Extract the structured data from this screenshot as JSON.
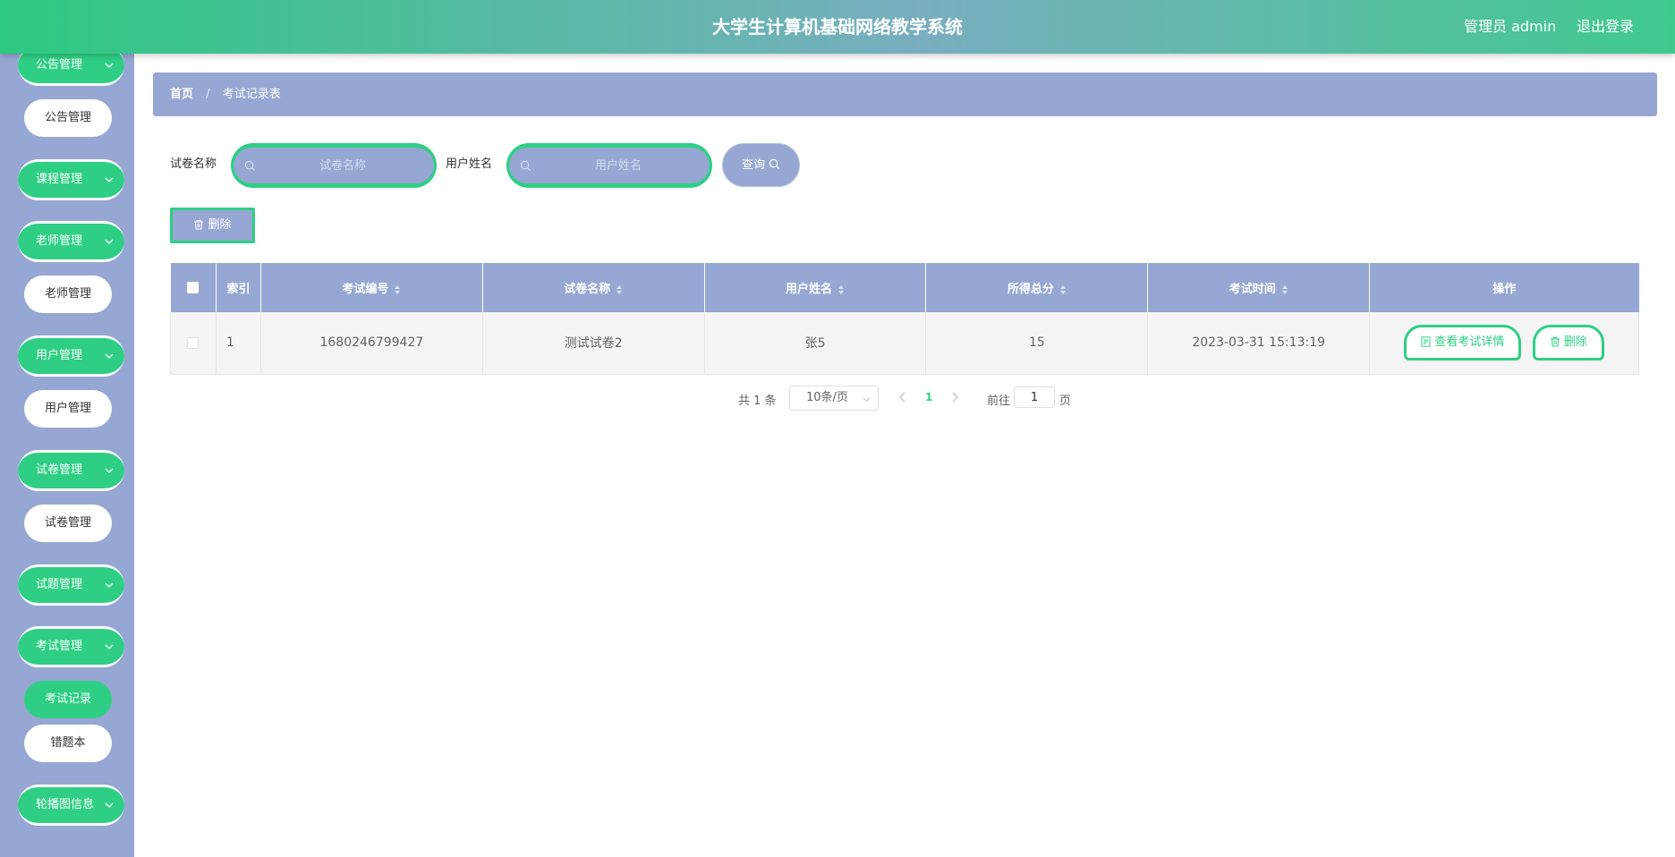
{
  "header": {
    "title": "大学生计算机基础网络教学系统",
    "user": "管理员 admin",
    "logout": "退出登录"
  },
  "sidebar": {
    "groups": [
      {
        "label": "公告管理",
        "items": [
          "公告管理"
        ]
      },
      {
        "label": "课程管理",
        "items": []
      },
      {
        "label": "老师管理",
        "items": [
          "老师管理"
        ]
      },
      {
        "label": "用户管理",
        "items": [
          "用户管理"
        ]
      },
      {
        "label": "试卷管理",
        "items": [
          "试卷管理"
        ]
      },
      {
        "label": "试题管理",
        "items": []
      },
      {
        "label": "考试管理",
        "items": [
          "考试记录",
          "错题本"
        ]
      },
      {
        "label": "轮播图信息",
        "items": []
      }
    ],
    "active_item": "考试记录"
  },
  "breadcrumb": {
    "home": "首页",
    "separator": "/",
    "current": "考试记录表"
  },
  "search": {
    "paper_label": "试卷名称",
    "paper_placeholder": "试卷名称",
    "user_label": "用户姓名",
    "user_placeholder": "用户姓名",
    "query_button": "查询"
  },
  "toolbar": {
    "delete_label": "删除"
  },
  "table": {
    "columns": [
      "索引",
      "考试编号",
      "试卷名称",
      "用户姓名",
      "所得总分",
      "考试时间",
      "操作"
    ],
    "rows": [
      {
        "index": "1",
        "exam_no": "1680246799427",
        "paper": "测试试卷2",
        "user": "张5",
        "score": "15",
        "time": "2023-03-31 15:13:19"
      }
    ],
    "view_label": "查看考试详情",
    "delete_label": "删除"
  },
  "pagination": {
    "total": "共 1 条",
    "page_size": "10条/页",
    "current_page": "1",
    "goto_label": "前往",
    "goto_value": "1",
    "page_suffix": "页"
  },
  "colors": {
    "accent": "#2ecf84",
    "panel": "#96a7d3"
  }
}
